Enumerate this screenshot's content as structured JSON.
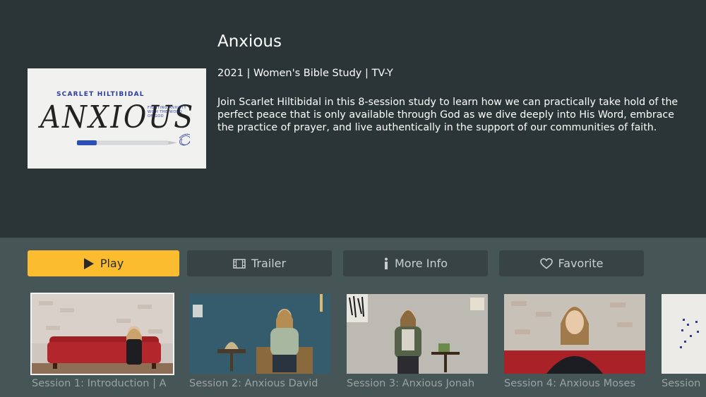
{
  "show": {
    "title": "Anxious",
    "meta": "2021 | Women's Bible Study | TV-Y",
    "description": "Join Scarlet Hiltibidal in this 8-session study to learn how we can practically take hold of the perfect peace that is only available through God as we dive deeply into His Word, embrace the practice of prayer, and live authentically in the support of our communities of faith."
  },
  "poster": {
    "author": "SCARLET HILTIBIDAL",
    "title_word": "ANXIOUS",
    "tagline": "Fighting anxiety with the word of God"
  },
  "buttons": {
    "play": "Play",
    "trailer": "Trailer",
    "more_info": "More Info",
    "favorite": "Favorite"
  },
  "episodes": [
    {
      "caption": "Session 1: Introduction | A"
    },
    {
      "caption": "Session 2: Anxious David"
    },
    {
      "caption": "Session 3: Anxious Jonah"
    },
    {
      "caption": "Session 4: Anxious Moses"
    },
    {
      "caption": "Session"
    }
  ],
  "colors": {
    "background_top": "#2b3436",
    "background_bottom": "#465556",
    "accent": "#fbbd2f",
    "button": "#374345",
    "caption": "#99a3a4"
  }
}
